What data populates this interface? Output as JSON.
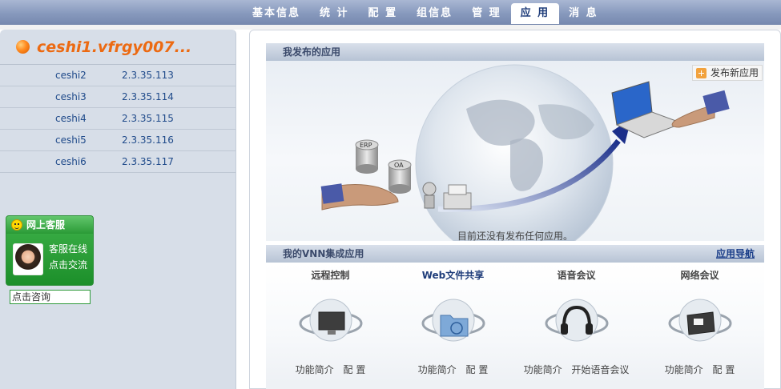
{
  "nav": {
    "tabs": [
      {
        "label": "基本信息"
      },
      {
        "label": "统 计"
      },
      {
        "label": "配 置"
      },
      {
        "label": "组信息"
      },
      {
        "label": "管 理"
      },
      {
        "label": "应 用"
      },
      {
        "label": "消 息"
      }
    ],
    "active": "应 用"
  },
  "sidebar": {
    "title": "ceshi1.vfrgy007...",
    "items": [
      {
        "name": "ceshi2",
        "ip": "2.3.35.113"
      },
      {
        "name": "ceshi3",
        "ip": "2.3.35.114"
      },
      {
        "name": "ceshi4",
        "ip": "2.3.35.115"
      },
      {
        "name": "ceshi5",
        "ip": "2.3.35.116"
      },
      {
        "name": "ceshi6",
        "ip": "2.3.35.117"
      }
    ],
    "service": {
      "title": "网上客服",
      "line1": "客服在线",
      "line2": "点击交流",
      "consult": "点击咨询"
    }
  },
  "main": {
    "published": {
      "title": "我发布的应用",
      "publish_button": "发布新应用",
      "empty_note": "目前还没有发布任何应用。",
      "server_labels": [
        "ERP",
        "OA"
      ]
    },
    "integrated": {
      "title": "我的VNN集成应用",
      "nav_link": "应用导航",
      "apps": [
        {
          "title": "远程控制",
          "links": [
            "功能简介",
            "配 置"
          ]
        },
        {
          "title": "Web文件共享",
          "links": [
            "功能简介",
            "配 置"
          ]
        },
        {
          "title": "语音会议",
          "links": [
            "功能简介",
            "开始语音会议"
          ]
        },
        {
          "title": "网络会议",
          "links": [
            "功能简介",
            "配 置"
          ]
        }
      ]
    }
  },
  "colors": {
    "nav_bg": "#8799bd",
    "accent_orange": "#ec6a12",
    "link_blue": "#1f4a8a",
    "service_green": "#1c8f2a"
  }
}
